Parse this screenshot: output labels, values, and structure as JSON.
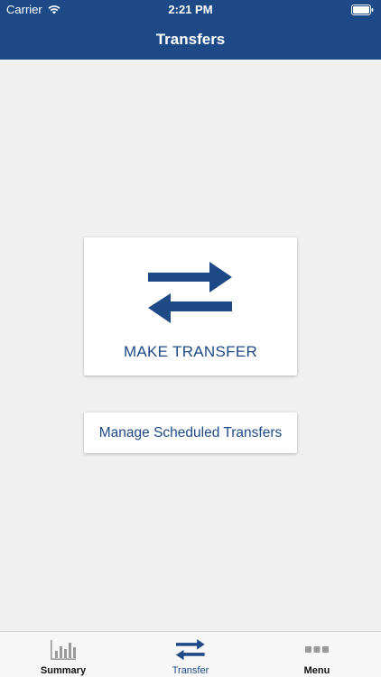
{
  "status_bar": {
    "carrier": "Carrier",
    "time": "2:21 PM"
  },
  "nav": {
    "title": "Transfers"
  },
  "main": {
    "make_transfer_label": "MAKE TRANSFER",
    "manage_scheduled_label": "Manage Scheduled Transfers"
  },
  "tabs": [
    {
      "label": "Summary",
      "icon": "bar-chart-icon",
      "active": false
    },
    {
      "label": "Transfer",
      "icon": "transfer-arrows-icon",
      "active": true
    },
    {
      "label": "Menu",
      "icon": "more-dots-icon",
      "active": false
    }
  ],
  "colors": {
    "brand": "#1d4a86",
    "background": "#f0f0f0",
    "inactive_icon": "#9a9a9a"
  }
}
